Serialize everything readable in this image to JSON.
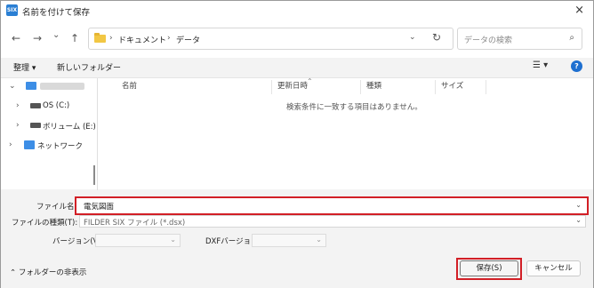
{
  "window": {
    "title": "名前を付けて保存",
    "app_icon_text": "SIX",
    "close_icon": "×"
  },
  "nav": {
    "back": "←",
    "forward": "→",
    "recent": "⌄",
    "up": "↑"
  },
  "address": {
    "breadcrumbs": [
      "ドキュメント",
      "データ"
    ],
    "separator": "›",
    "dropdown_icon": "⌄",
    "refresh_icon": "↻"
  },
  "search": {
    "placeholder": "データの検索",
    "icon": "⌕"
  },
  "toolbar": {
    "organize": "整理 ▾",
    "new_folder": "新しいフォルダー",
    "view_icon": "☰ ▾",
    "help_icon": "?"
  },
  "tree": {
    "items": [
      {
        "chevron": "⌄",
        "label": ""
      },
      {
        "chevron": "›",
        "label": "OS (C:)"
      },
      {
        "chevron": "›",
        "label": "ボリューム (E:)"
      },
      {
        "chevron": "›",
        "label": "ネットワーク"
      }
    ]
  },
  "list": {
    "columns": [
      "名前",
      "更新日時",
      "種類",
      "サイズ"
    ],
    "sort_icon": "⌃",
    "empty_message": "検索条件に一致する項目はありません。"
  },
  "form": {
    "filename_label": "ファイル名(N):",
    "filename_value": "電気図面",
    "filetype_label": "ファイルの種類(T):",
    "filetype_value": "FILDER SIX ファイル (*.dsx)",
    "version_label": "バージョン(V):",
    "dxf_label": "DXFバージョン:",
    "chevron": "⌄"
  },
  "footer": {
    "hide_folders": "⌃ フォルダーの非表示",
    "save": "保存(S)",
    "cancel": "キャンセル"
  },
  "colors": {
    "highlight_red": "#d21f26",
    "folder_yellow": "#f2c744",
    "accent_blue": "#1e6fd0"
  }
}
